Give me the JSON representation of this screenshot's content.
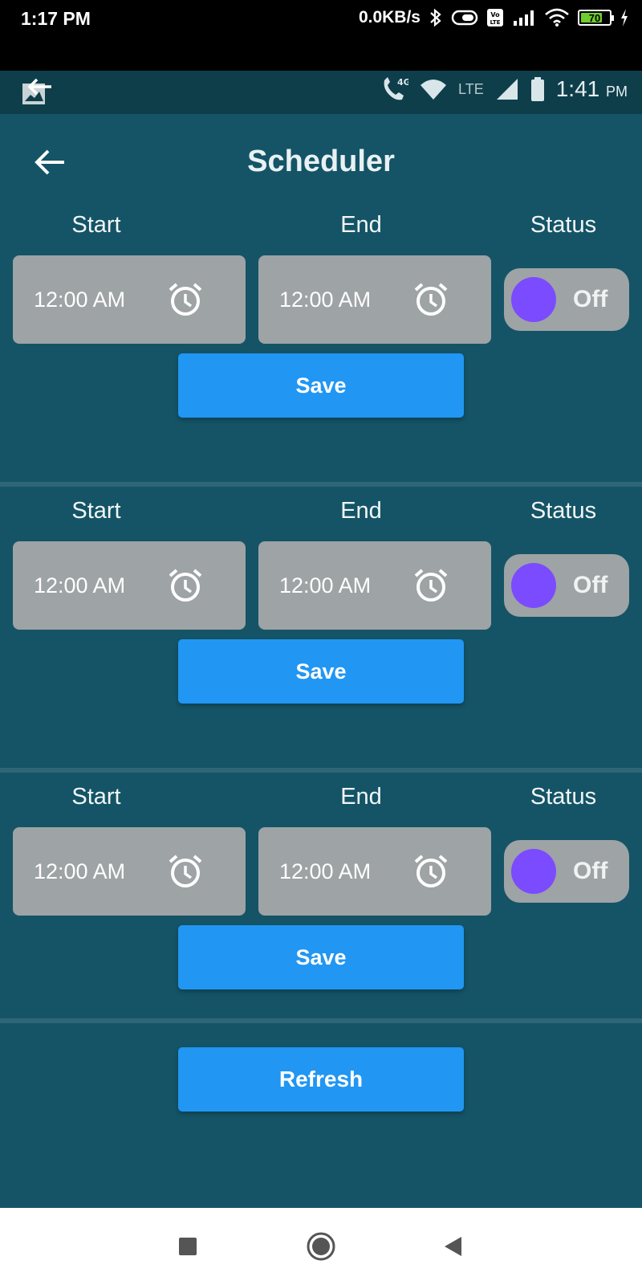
{
  "device_status": {
    "time": "1:17 PM",
    "network_speed": "0.0KB/s",
    "battery_level": "70",
    "icons": [
      "bluetooth-icon",
      "vibrate-icon",
      "volte-icon",
      "signal-icon",
      "wifi-icon",
      "battery-icon",
      "charging-icon"
    ]
  },
  "inner_status": {
    "time": "1:41",
    "ampm": "PM",
    "network_label": "LTE",
    "call_label": "4G"
  },
  "header": {
    "title": "Scheduler"
  },
  "schedules": [
    {
      "start_label": "Start",
      "end_label": "End",
      "status_label": "Status",
      "start_time": "12:00 AM",
      "end_time": "12:00 AM",
      "toggle_state": "Off",
      "save_label": "Save"
    },
    {
      "start_label": "Start",
      "end_label": "End",
      "status_label": "Status",
      "start_time": "12:00 AM",
      "end_time": "12:00 AM",
      "toggle_state": "Off",
      "save_label": "Save"
    },
    {
      "start_label": "Start",
      "end_label": "End",
      "status_label": "Status",
      "start_time": "12:00 AM",
      "end_time": "12:00 AM",
      "toggle_state": "Off",
      "save_label": "Save"
    }
  ],
  "refresh_label": "Refresh",
  "colors": {
    "app_background": "#145466",
    "button_blue": "#2196f3",
    "toggle_knob": "#7b4bff",
    "field_gray": "#9ea3a5"
  }
}
